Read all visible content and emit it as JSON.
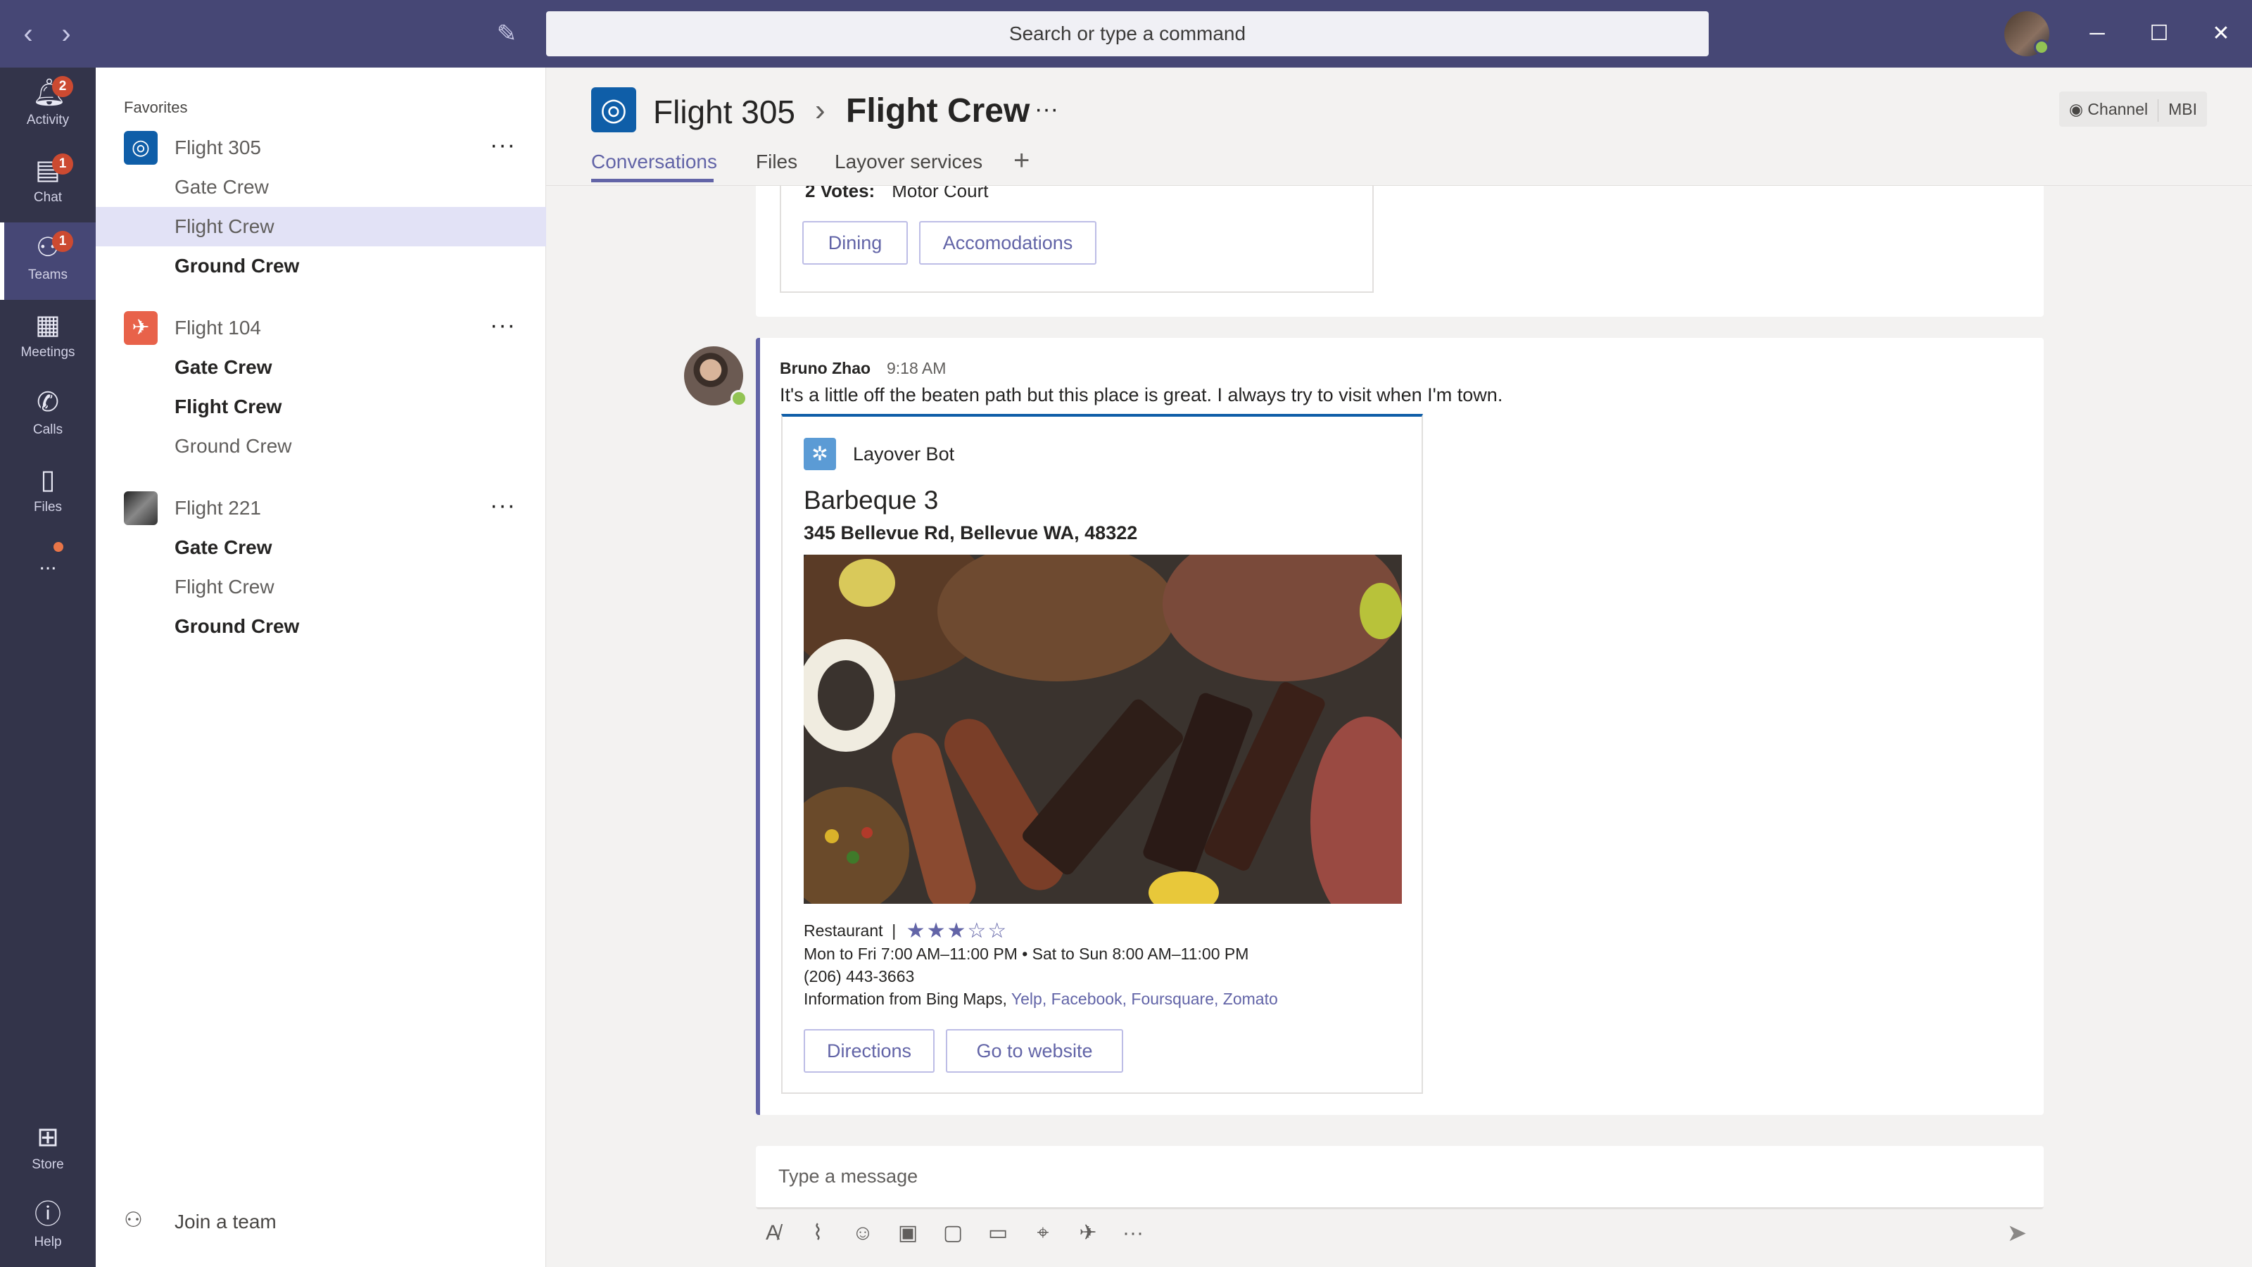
{
  "search": {
    "placeholder": "Search or type a command"
  },
  "appbar": {
    "items": [
      {
        "label": "Activity",
        "icon": "bell-icon",
        "badge": "2"
      },
      {
        "label": "Chat",
        "icon": "chat-icon",
        "badge": "1"
      },
      {
        "label": "Teams",
        "icon": "teams-icon",
        "badge": "1"
      },
      {
        "label": "Meetings",
        "icon": "calendar-icon"
      },
      {
        "label": "Calls",
        "icon": "phone-icon"
      },
      {
        "label": "Files",
        "icon": "file-icon"
      },
      {
        "label": "...",
        "icon": "more-icon"
      },
      {
        "label": "Store",
        "icon": "store-icon"
      },
      {
        "label": "Help",
        "icon": "help-icon"
      }
    ]
  },
  "sidebar": {
    "favorites_label": "Favorites",
    "teams": [
      {
        "name": "Flight 305",
        "color": "#0f5ea8",
        "channels": [
          "Gate Crew",
          "Flight Crew",
          "Ground Crew"
        ]
      },
      {
        "name": "Flight 104",
        "color": "#e8624a",
        "channels": [
          "Gate Crew",
          "Flight Crew",
          "Ground Crew"
        ]
      },
      {
        "name": "Flight 221",
        "color": "#3b3b3b",
        "channels": [
          "Gate Crew",
          "Flight Crew",
          "Ground Crew"
        ]
      }
    ],
    "join_label": "Join a team"
  },
  "header": {
    "team": "Flight 305",
    "channel": "Flight Crew",
    "tabs": [
      "Conversations",
      "Files",
      "Layover services"
    ],
    "chip_left": "Channel",
    "chip_right": "MBI"
  },
  "previous_card": {
    "votes_label": "2 Votes:",
    "votes_value": "Motor Court",
    "buttons": [
      "Dining",
      "Accomodations"
    ]
  },
  "message": {
    "author": "Bruno Zhao",
    "time": "9:18 AM",
    "text": "It's a little off the beaten path but this place is great. I always try to visit when I'm town.",
    "card": {
      "bot_name": "Layover Bot",
      "title": "Barbeque 3",
      "address": "345 Bellevue Rd, Bellevue WA, 48322",
      "category": "Restaurant",
      "rating": 3,
      "rating_max": 5,
      "hours": "Mon to Fri 7:00 AM–11:00 PM • Sat to Sun 8:00 AM–11:00 PM",
      "phone": "(206) 443-3663",
      "source_prefix": "Information from Bing Maps,",
      "source_links": [
        "Yelp,",
        "Facebook,",
        "Foursquare,",
        "Zomato"
      ],
      "buttons": [
        "Directions",
        "Go to website"
      ]
    }
  },
  "composer": {
    "placeholder": "Type a message"
  },
  "colors": {
    "accent": "#6264a7",
    "titlebar": "#464775",
    "appbar": "#33344a",
    "badge": "#cc4a31"
  }
}
